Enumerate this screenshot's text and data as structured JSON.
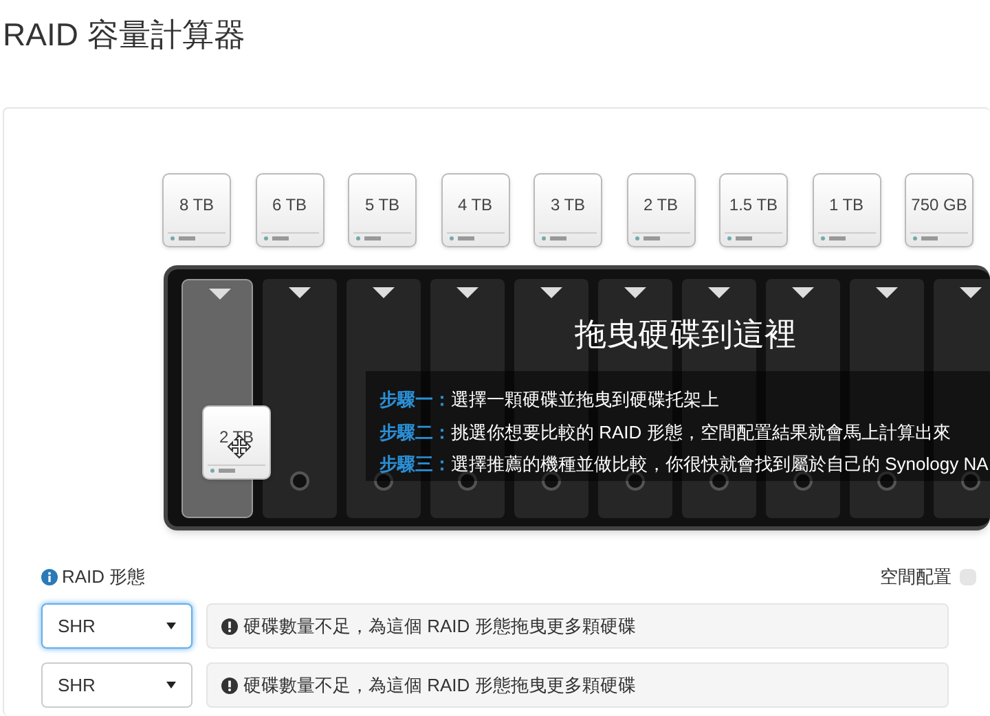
{
  "title": "RAID 容量計算器",
  "drives": [
    "8 TB",
    "6 TB",
    "5 TB",
    "4 TB",
    "3 TB",
    "2 TB",
    "1.5 TB",
    "1 TB",
    "750 GB"
  ],
  "rack": {
    "heading": "拖曳硬碟到這裡",
    "tray_drive": "2 TB",
    "steps": [
      {
        "label": "步驟一：",
        "text": "選擇一顆硬碟並拖曳到硬碟托架上"
      },
      {
        "label": "步驟二：",
        "text": "挑選你想要比較的 RAID 形態，空間配置結果就會馬上計算出來"
      },
      {
        "label": "步驟三：",
        "text": "選擇推薦的機種並做比較，你很快就會找到屬於自己的 Synology NA"
      }
    ]
  },
  "raid_label": "RAID 形態",
  "legend_label": "空間配置",
  "rows": [
    {
      "value": "SHR",
      "focused": true,
      "message": "硬碟數量不足，為這個 RAID 形態拖曳更多顆硬碟"
    },
    {
      "value": "SHR",
      "focused": false,
      "message": "硬碟數量不足，為這個 RAID 形態拖曳更多顆硬碟"
    }
  ]
}
